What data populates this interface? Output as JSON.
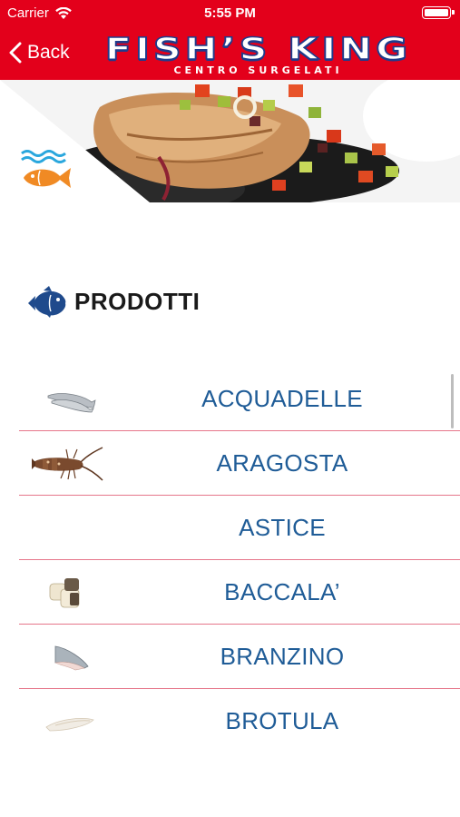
{
  "status_bar": {
    "carrier": "Carrier",
    "time": "5:55 PM"
  },
  "nav": {
    "back_label": "Back",
    "logo_title": "FISH’S KING",
    "logo_subtitle": "CENTRO SURGELATI"
  },
  "section": {
    "title": "PRODOTTI",
    "icon": "fish-icon"
  },
  "products": [
    {
      "name": "ACQUADELLE",
      "thumb": "small-fish-thumb"
    },
    {
      "name": "ARAGOSTA",
      "thumb": "lobster-thumb"
    },
    {
      "name": "ASTICE",
      "thumb": ""
    },
    {
      "name": "BACCALA’",
      "thumb": "cod-pieces-thumb"
    },
    {
      "name": "BRANZINO",
      "thumb": "seabass-fillet-thumb"
    },
    {
      "name": "BROTULA",
      "thumb": "brotula-fillet-thumb"
    }
  ],
  "colors": {
    "brand_red": "#e3001b",
    "brand_blue": "#1f3c8c",
    "product_text": "#1f5c97",
    "separator": "#e6768a",
    "wave_blue": "#2aa7dd",
    "fish_orange": "#f08a24"
  }
}
